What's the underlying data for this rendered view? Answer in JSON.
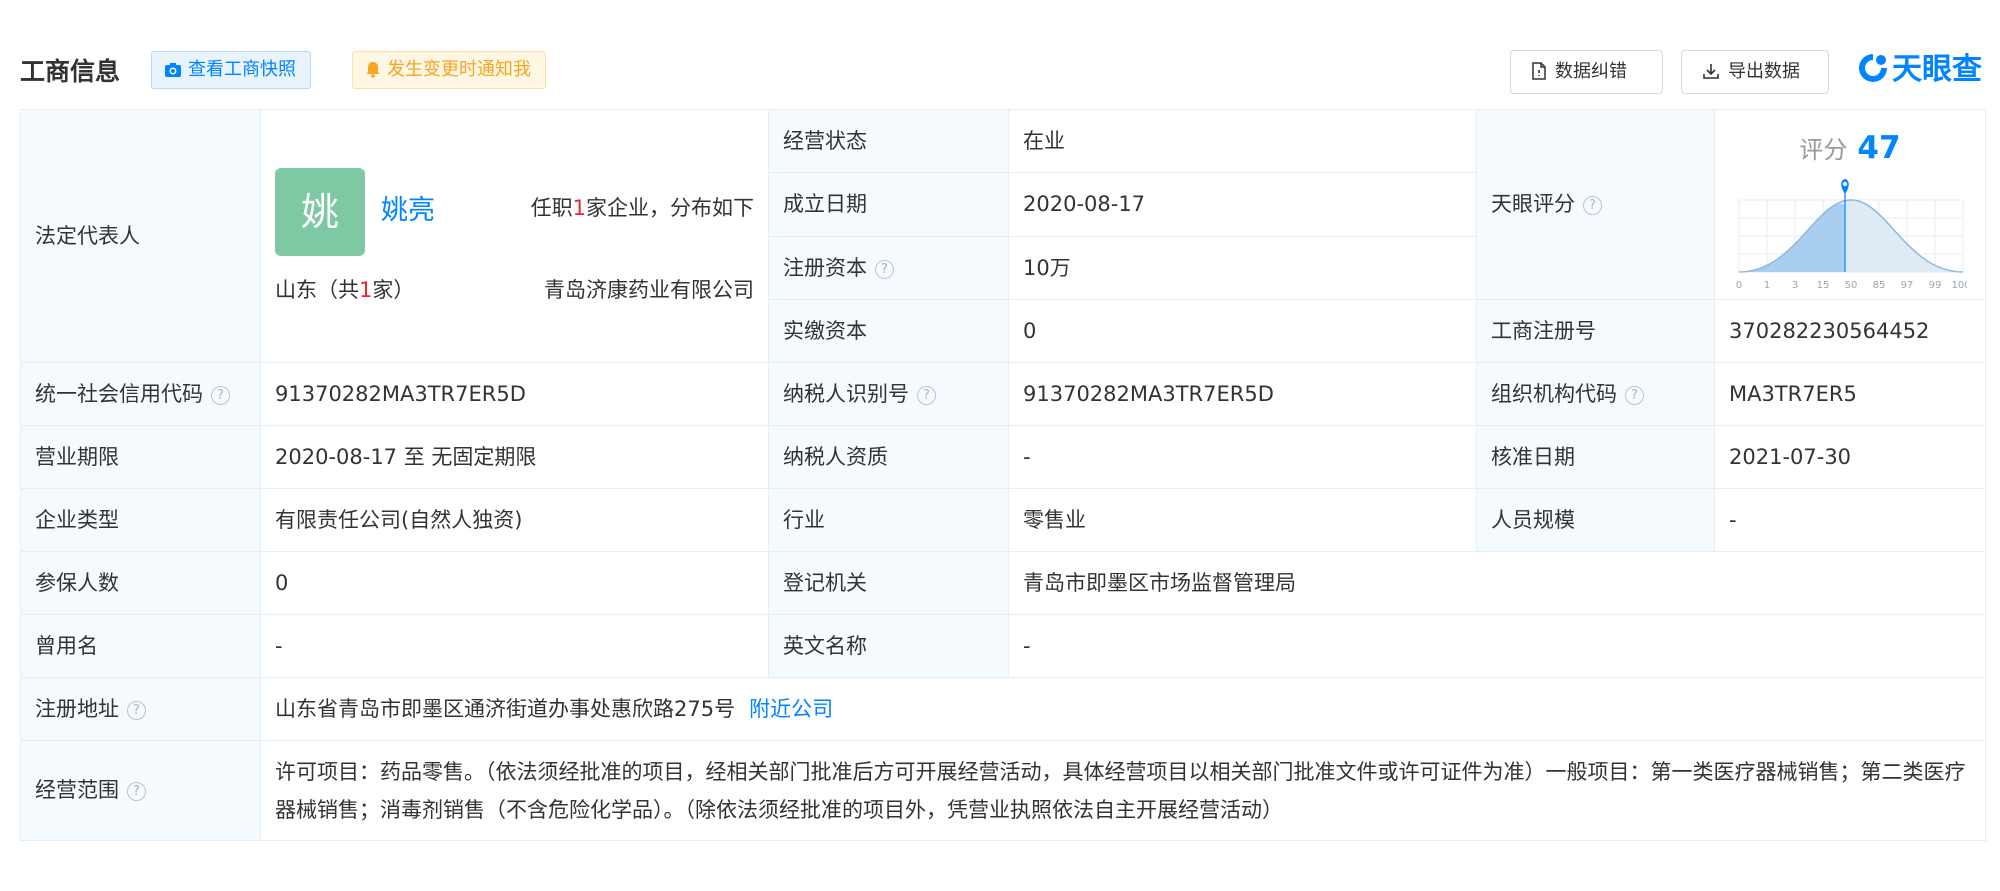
{
  "header": {
    "title": "工商信息",
    "snapshot_label": "查看工商快照",
    "notify_label": "发生变更时通知我",
    "correct_label": "数据纠错",
    "export_label": "导出数据",
    "brand": "天眼查"
  },
  "labels": {
    "legal_rep": "法定代表人",
    "status": "经营状态",
    "founded": "成立日期",
    "reg_capital": "注册资本",
    "paid_capital": "实缴资本",
    "tianyan_score": "天眼评分",
    "reg_no": "工商注册号",
    "credit_code": "统一社会信用代码",
    "taxpayer_id": "纳税人识别号",
    "org_code": "组织机构代码",
    "term": "营业期限",
    "taxpayer_qual": "纳税人资质",
    "approval_date": "核准日期",
    "company_type": "企业类型",
    "industry": "行业",
    "staff_size": "人员规模",
    "insured": "参保人数",
    "reg_authority": "登记机关",
    "former_name": "曾用名",
    "english_name": "英文名称",
    "reg_address": "注册地址",
    "scope": "经营范围"
  },
  "values": {
    "rep_avatar_char": "姚",
    "rep_name": "姚亮",
    "rep_info_pre": "任职",
    "rep_info_count": "1",
    "rep_info_post": "家企业，分布如下",
    "rep_region_pre": "山东（共",
    "rep_region_count": "1",
    "rep_region_post": "家）",
    "rep_company": "青岛济康药业有限公司",
    "status": "在业",
    "founded": "2020-08-17",
    "reg_capital": "10万",
    "paid_capital": "0",
    "reg_no": "370282230564452",
    "credit_code": "91370282MA3TR7ER5D",
    "taxpayer_id": "91370282MA3TR7ER5D",
    "org_code": "MA3TR7ER5",
    "term": "2020-08-17 至 无固定期限",
    "taxpayer_qual": "-",
    "approval_date": "2021-07-30",
    "company_type": "有限责任公司(自然人独资)",
    "industry": "零售业",
    "staff_size": "-",
    "insured": "0",
    "reg_authority": "青岛市即墨区市场监督管理局",
    "former_name": "-",
    "english_name": "-",
    "reg_address": "山东省青岛市即墨区通济街道办事处惠欣路275号",
    "nearby_link": "附近公司",
    "scope": "许可项目：药品零售。（依法须经批准的项目，经相关部门批准后方可开展经营活动，具体经营项目以相关部门批准文件或许可证件为准）一般项目：第一类医疗器械销售；第二类医疗器械销售；消毒剂销售（不含危险化学品）。（除依法须经批准的项目外，凭营业执照依法自主开展经营活动）"
  },
  "score": {
    "label": "评分",
    "value": "47",
    "ticks": [
      "0",
      "1",
      "3",
      "15",
      "50",
      "85",
      "97",
      "99",
      "100"
    ]
  },
  "help_icon": "question-circle-icon",
  "colors": {
    "accent": "#0084ff",
    "label_bg": "#f5fafe",
    "border": "#e4eef6",
    "highlight": "#f5222d",
    "notify": "#f5a623",
    "avatar": "#7ec8a4"
  }
}
